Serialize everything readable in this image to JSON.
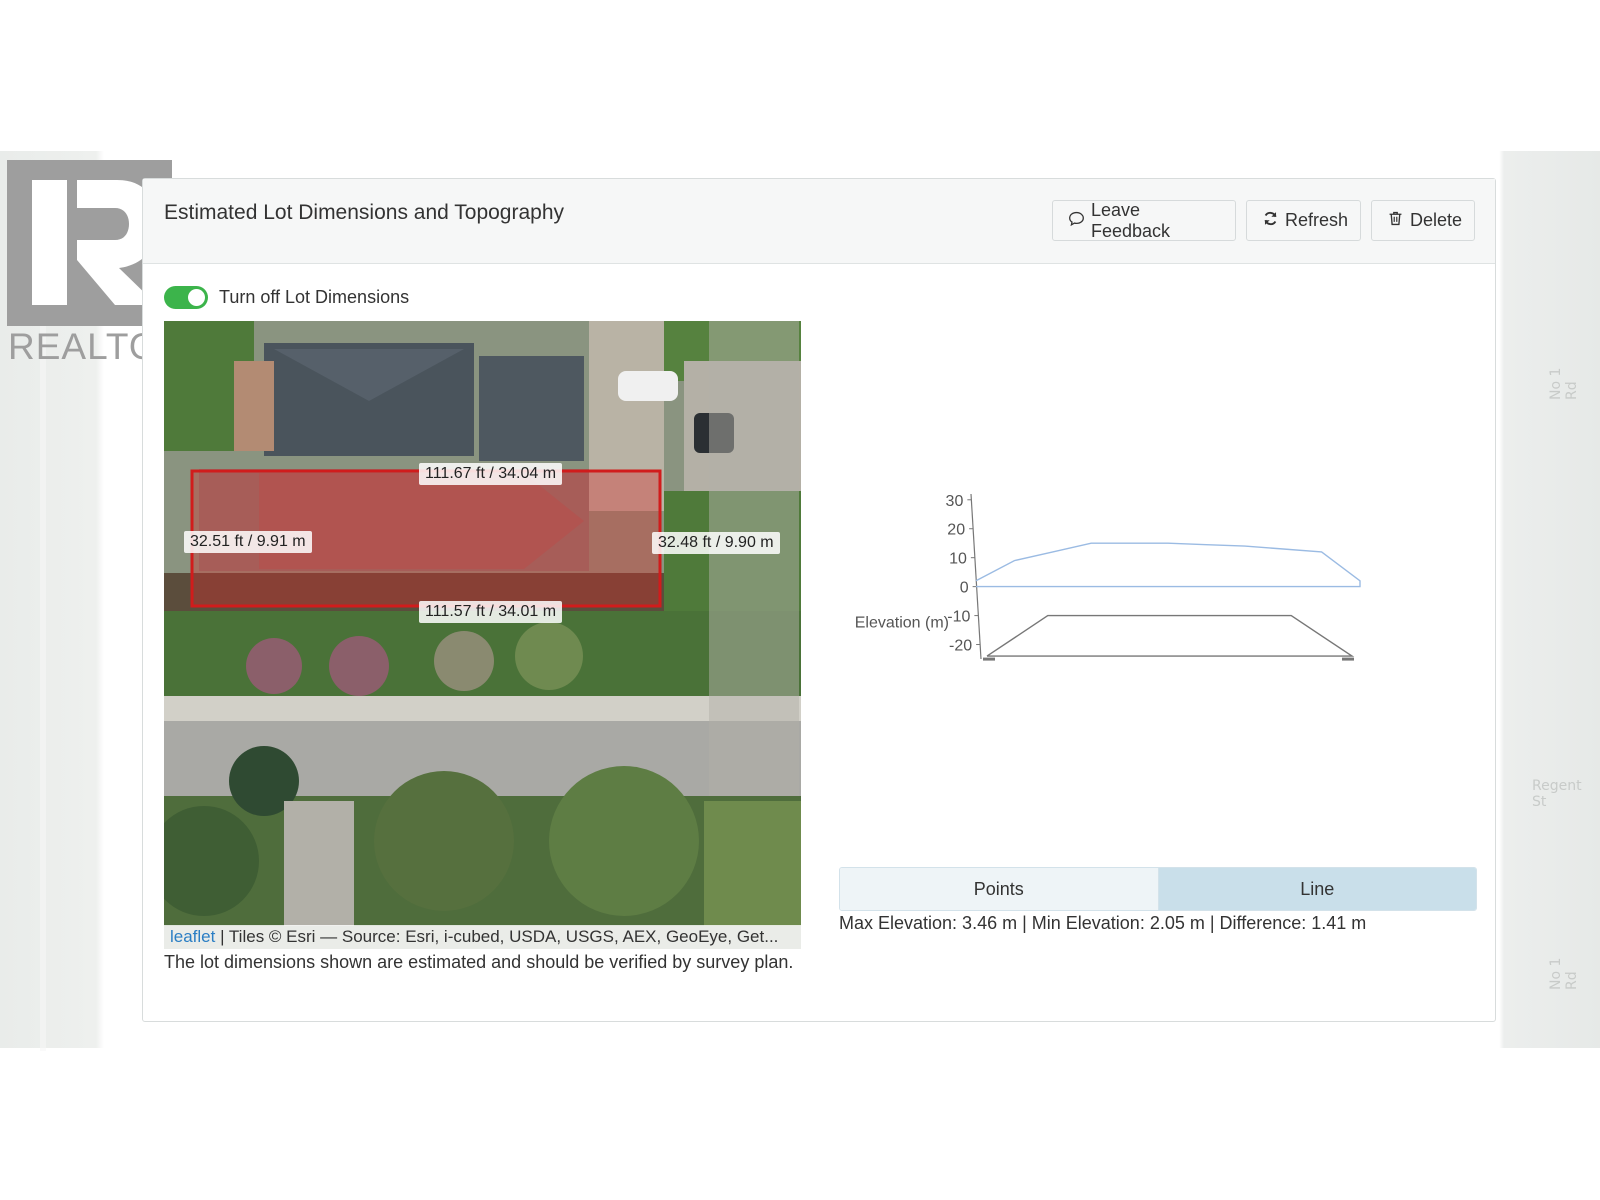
{
  "background": {
    "street_labels": [
      "No 1 Rd",
      "No 1 Rd",
      "Regent St"
    ]
  },
  "logo": {
    "word": "REALTOR"
  },
  "card": {
    "title": "Estimated Lot Dimensions and Topography",
    "buttons": {
      "feedback": "Leave Feedback",
      "refresh": "Refresh",
      "delete": "Delete"
    },
    "toggle": {
      "label": "Turn off Lot Dimensions",
      "on": true
    },
    "map": {
      "labels": {
        "top": "111.67 ft / 34.04 m",
        "left": "32.51 ft / 9.91 m",
        "right": "32.48 ft / 9.90 m",
        "bottom": "111.57 ft / 34.01 m"
      },
      "attribution_link": "leaflet",
      "attribution_text": " | Tiles © Esri — Source: Esri, i-cubed, USDA, USGS, AEX, GeoEye, Get..."
    },
    "disclaimer": "The lot dimensions shown are estimated and should be verified by survey plan."
  },
  "chart_data": {
    "type": "line",
    "title": "",
    "xlabel": "",
    "ylabel": "Elevation (m)",
    "y_ticks": [
      30,
      20,
      10,
      0,
      -10,
      -20
    ],
    "ylim": [
      -25,
      32
    ],
    "colors": {
      "profile": "#9bbbe3",
      "baseline": "#777777"
    },
    "series": [
      {
        "values": [
          2,
          9,
          12,
          15,
          15,
          15,
          14.5,
          14,
          13,
          12,
          2
        ]
      }
    ],
    "baseline_series": [
      {
        "values": [
          -24,
          -10,
          -10,
          -10,
          -10,
          -10,
          -24
        ]
      }
    ]
  },
  "topo": {
    "tabs": {
      "points": "Points",
      "line": "Line"
    },
    "active_tab": "Line",
    "stats": "Max Elevation: 3.46 m | Min Elevation: 2.05 m | Difference: 1.41 m"
  }
}
